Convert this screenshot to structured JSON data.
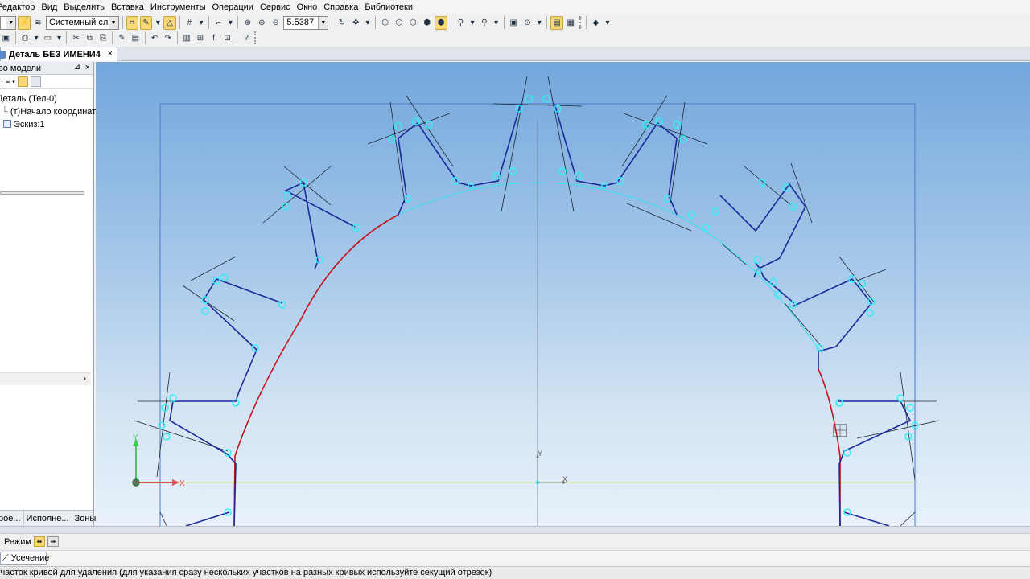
{
  "menu": [
    "Редактор",
    "Вид",
    "Выделить",
    "Вставка",
    "Инструменты",
    "Операции",
    "Сервис",
    "Окно",
    "Справка",
    "Библиотеки"
  ],
  "toolbar": {
    "layer_combo": "Системный слой",
    "zoom_value": "5.5387"
  },
  "tabs": {
    "document_tab": "Деталь БЕЗ ИМЕНИ4",
    "close_glyph": "×"
  },
  "tree_panel": {
    "title": "во модели",
    "pin_glyph": "⊿",
    "close_glyph": "×",
    "items": [
      "Деталь (Тел-0)",
      "(т)Начало координат",
      "Эскиз:1"
    ],
    "bottom_tabs": [
      "рое...",
      "Исполне...",
      "Зоны"
    ]
  },
  "viewport": {
    "axis_x": "X",
    "axis_y": "Y",
    "center_axis_x": "X",
    "center_axis_y": "Y"
  },
  "mode_bar": {
    "label": "Режим"
  },
  "command": {
    "label": "Усечение"
  },
  "status": {
    "text": "участок кривой для удаления (для указания сразу нескольких участков на разных кривых используйте секущий отрезок)"
  },
  "colors": {
    "accent_yellow": "#f6d878",
    "sketch_blue": "#1a2a9a",
    "trim_red": "#c4141e",
    "handle_cyan": "#2cf2f6"
  }
}
